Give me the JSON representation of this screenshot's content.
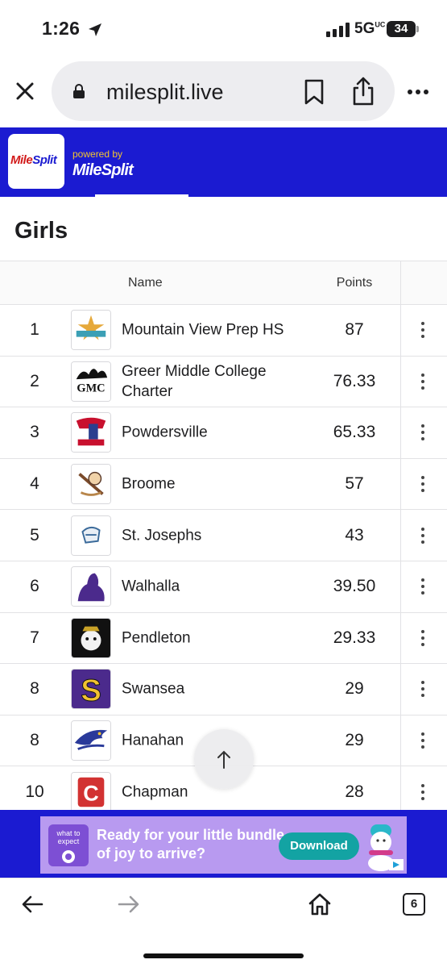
{
  "status_bar": {
    "time": "1:26",
    "network": "5G",
    "network_sup": "UC",
    "battery": "34"
  },
  "browser": {
    "url": "milesplit.live",
    "tab_count": "6"
  },
  "site_header": {
    "logo_text_a": "Mile",
    "logo_text_b": "Split",
    "powered_by": "powered by",
    "powered_logo": "MileSplit"
  },
  "section_title": "Girls",
  "table": {
    "columns": {
      "name": "Name",
      "points": "Points"
    },
    "rows": [
      {
        "place": "1",
        "team": "Mountain View Prep HS",
        "points": "87"
      },
      {
        "place": "2",
        "team": "Greer Middle College Charter",
        "points": "76.33"
      },
      {
        "place": "3",
        "team": "Powdersville",
        "points": "65.33"
      },
      {
        "place": "4",
        "team": "Broome",
        "points": "57"
      },
      {
        "place": "5",
        "team": "St. Josephs",
        "points": "43"
      },
      {
        "place": "6",
        "team": "Walhalla",
        "points": "39.50"
      },
      {
        "place": "7",
        "team": "Pendleton",
        "points": "29.33"
      },
      {
        "place": "8",
        "team": "Swansea",
        "points": "29"
      },
      {
        "place": "8",
        "team": "Hanahan",
        "points": "29"
      },
      {
        "place": "10",
        "team": "Chapman",
        "points": "28"
      }
    ]
  },
  "ad": {
    "brand_top": "what to",
    "brand_bottom": "expect",
    "headline": "Ready for your little bundle of joy to arrive?",
    "cta": "Download"
  },
  "colors": {
    "brand_blue": "#1b1bd1",
    "brand_red": "#d21b1b",
    "ad_purple": "#b89af0"
  }
}
